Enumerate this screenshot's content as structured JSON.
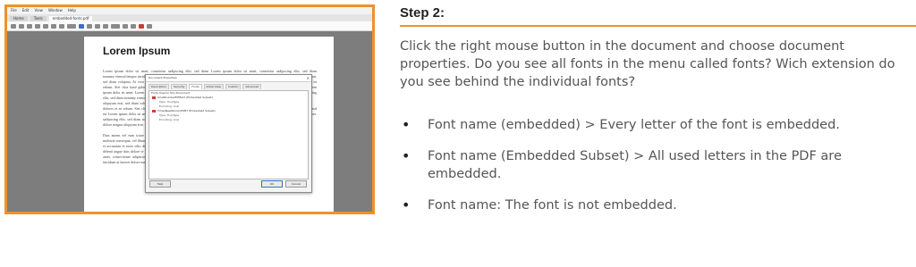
{
  "screenshot": {
    "border_color": "#f0902e",
    "menu": [
      "File",
      "Edit",
      "View",
      "Window",
      "Help"
    ],
    "tabs": [
      "Home",
      "Tools",
      "embedded-fonts.pdf"
    ],
    "document": {
      "title": "Lorem Ipsum",
      "left_paragraphs": [
        "Lorem ipsum dolor sit amet, consetetur sadipscing elitr, sed diam nonumy eirmod tempor invidunt ut labore et dolore magna aliquyam erat, sed diam voluptua. At vero eos et accusam et justo duo dolores et ea rebum. Stet clita kasd gubergren, no sea takimata sanctus est Lorem ipsum dolor sit amet. Lorem ipsum dolor sit amet, consetetur sadipscing elitr, sed diam nonumy eirmod tempor invidunt ut labore et dolore magna aliquyam erat, sed diam voluptua. At vero eos et accusam et justo duo dolores et ea rebum. Stet clita kasd gubergren, no sea takimata sanctus est Lorem ipsum dolor sit amet. Lorem ipsum dolor sit amet, consetetur sadipscing elitr, sed diam nonumy eirmod tempor invidunt ut labore et dolore magna aliquyam erat.",
        "Duis autem vel eum iriure dolor in hendrerit in vulputate velit esse molestie consequat, vel illum dolore eu feugiat nulla facilisis at vero eros et accumsan et iusto odio dignissim qui blandit praesent luptatum zzril delenit augue duis dolore te feugait nulla facilisi. Lorem ipsum dolor sit amet, consectetuer adipiscing elit, sed diam nonummy nibh euismod tincidunt ut laoreet dolore magna aliquam erat volutpat."
      ],
      "right_paragraphs": [
        "Lorem ipsum dolor sit amet, consetetur sadipscing elitr, sed diam nonumy eirmod tempor invidunt ut labore et dolore magna aliquyam erat, sed diam voluptua. At vero eos et accusam et justo duo dolores et ea rebum. Stet clita kasd gubergren, no sea takimata sanctus est Lorem ipsum dolor sit amet. Lorem ipsum dolor sit amet, consetetur sadipscing elitr, sed diam nonumy eirmod tempor invidunt ut labore.",
        "At vero eos et accusam et justo duo dolores et ea rebum. Stet clita kasd gubergren, no sea takimata sanctus est Lorem ipsum dolor sit amet. Lorem ipsum dolor sit amet, consetetur sadipscing elitr, sed diam."
      ]
    },
    "dialog": {
      "title": "Document Properties",
      "close": "✕",
      "tabs": [
        "Description",
        "Security",
        "Fonts",
        "Initial View",
        "Custom",
        "Advanced"
      ],
      "active_tab": "Fonts",
      "caption": "Fonts Used in this Document",
      "fonts": [
        {
          "name": "ArialRoundedMTBold (Embedded Subset)",
          "level": 1,
          "pdf": true
        },
        {
          "name": "Type: TrueType",
          "level": 2
        },
        {
          "name": "Encoding: Ansi",
          "level": 2
        },
        {
          "name": "TimesNewRomanPSMT (Embedded Subset)",
          "level": 1,
          "pdf": true
        },
        {
          "name": "Type: TrueType",
          "level": 2
        },
        {
          "name": "Encoding: Ansi",
          "level": 2
        }
      ],
      "buttons": {
        "help": "Help",
        "ok": "OK",
        "cancel": "Cancel"
      }
    }
  },
  "instructions": {
    "step_title": "Step 2:",
    "accent_color": "#f0902e",
    "intro": "Click the right mouse button in the document and choose document properties. Do you see all fonts in the menu called fonts? Wich extension do you see behind the individual fonts?",
    "bullets": [
      "Font name (embedded) > Every letter of the font is embedded.",
      "Font name (Embedded Subset) > All used letters in the PDF are embedded.",
      "Font name: The font is not embedded."
    ]
  }
}
